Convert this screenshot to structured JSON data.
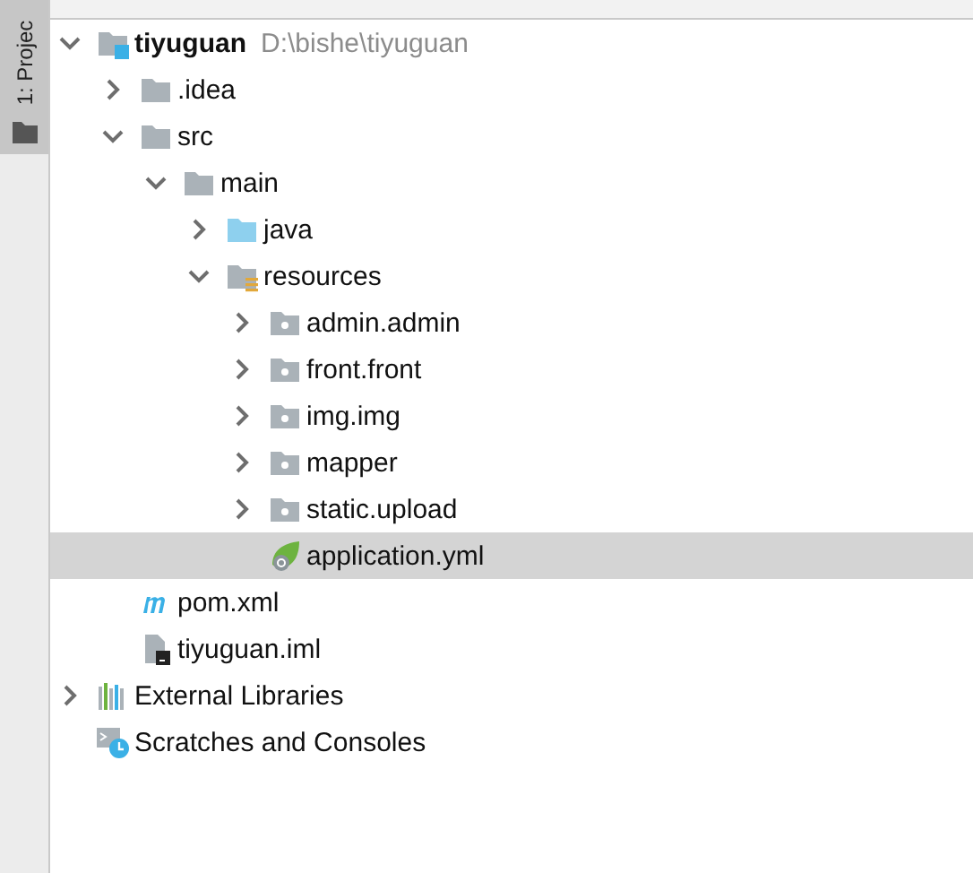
{
  "tool_stripe": {
    "tabs": [
      {
        "label": "1: Projec",
        "selected": true
      }
    ]
  },
  "tree": [
    {
      "kind": "module",
      "label": "tiyuguan",
      "path": "D:\\bishe\\tiyuguan",
      "expanded": true,
      "selected": false,
      "children": [
        {
          "kind": "folder",
          "label": ".idea",
          "expanded": false,
          "selected": false
        },
        {
          "kind": "folder",
          "label": "src",
          "expanded": true,
          "selected": false,
          "children": [
            {
              "kind": "folder",
              "label": "main",
              "expanded": true,
              "selected": false,
              "children": [
                {
                  "kind": "source",
                  "label": "java",
                  "expanded": false,
                  "selected": false
                },
                {
                  "kind": "resources",
                  "label": "resources",
                  "expanded": true,
                  "selected": false,
                  "children": [
                    {
                      "kind": "package",
                      "label": "admin.admin",
                      "expanded": false,
                      "selected": false
                    },
                    {
                      "kind": "package",
                      "label": "front.front",
                      "expanded": false,
                      "selected": false
                    },
                    {
                      "kind": "package",
                      "label": "img.img",
                      "expanded": false,
                      "selected": false
                    },
                    {
                      "kind": "package",
                      "label": "mapper",
                      "expanded": false,
                      "selected": false
                    },
                    {
                      "kind": "package",
                      "label": "static.upload",
                      "expanded": false,
                      "selected": false
                    },
                    {
                      "kind": "yml",
                      "label": "application.yml",
                      "selected": true
                    }
                  ]
                }
              ]
            }
          ]
        },
        {
          "kind": "maven",
          "label": "pom.xml",
          "selected": false
        },
        {
          "kind": "iml",
          "label": "tiyuguan.iml",
          "selected": false
        }
      ]
    },
    {
      "kind": "libraries",
      "label": "External Libraries",
      "expanded": false,
      "selected": false
    },
    {
      "kind": "scratches",
      "label": "Scratches and Consoles",
      "selected": false
    }
  ]
}
